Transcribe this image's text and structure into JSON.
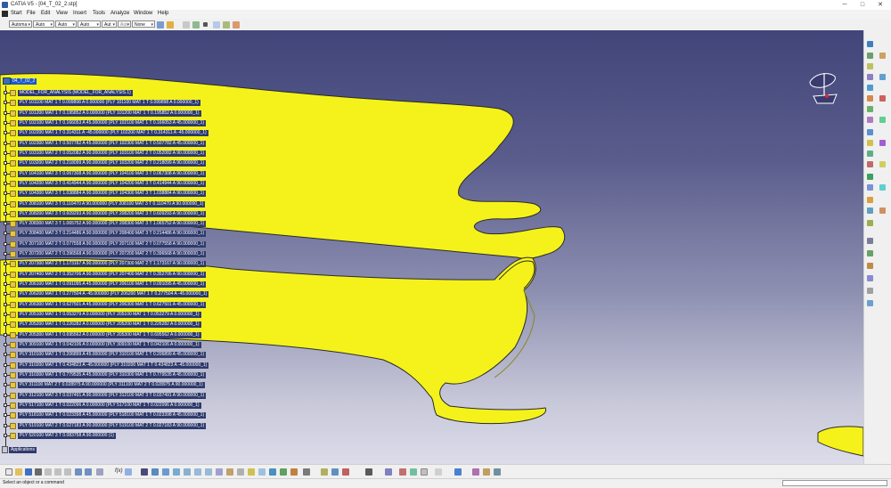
{
  "window": {
    "title": "CATIA V5 - [04_T_02_2.stp]",
    "minimize_glyph": "─",
    "maximize_glyph": "□",
    "close_glyph": "✕"
  },
  "menu": [
    "Start",
    "File",
    "Edit",
    "View",
    "Insert",
    "Tools",
    "Analyze",
    "Window",
    "Help"
  ],
  "properties_toolbar": {
    "selects": [
      "Automa",
      "Auto",
      "Auto",
      "Auto",
      "Aut",
      "Aut",
      "None"
    ]
  },
  "tree": {
    "root_label": "04_T_02_2",
    "rows": [
      {
        "label": "MODEL_FOR_ANALYSIS (MODEL_FOR_ANALYSIS.1)"
      },
      {
        "label": "PLY 101100 MAT 1 T 0.099898 A 0.000000 (PLY 101100 MAT 1 T 0.099898 A 0.000000_1)"
      },
      {
        "label": "PLY 101200 MAT 1 T 0.195852 A 0.000000 (PLY 101200 MAT 1 T 0.195852 A 0.000000_1)"
      },
      {
        "label": "PLY 102100 MAT 1 T 0.166053 A 45.000000 (PLY 102100 MAT 1 T 0.166053 A 45.000000_1)"
      },
      {
        "label": "PLY 102200 MAT 1 T 0.314311 A -45.000000 (PLY 102200 MAT 1 T 0.314311 A -45.000000_1)"
      },
      {
        "label": "PLY 102300 MAT 1 T 0.507782 A 45.000000 (PLY 102300 MAT 1 T 0.507782 A 45.000000_1)"
      },
      {
        "label": "PLY 103100 MAT 2 T 0.052082 A 90.000000 (PLY 103100 MAT 2 T 0.052082 A 90.000000_1)"
      },
      {
        "label": "PLY 103200 MAT 2 T 0.218099 A 90.000000 (PLY 103200 MAT 2 T 0.218099 A 90.000000_1)"
      },
      {
        "label": "PLY 104100 MAT 3 T 0.067308 A 90.000000 (PLY 104100 MAT 3 T 0.067308 A 90.000000_1)"
      },
      {
        "label": "PLY 104200 MAT 3 T 0.414944 A 90.000000 (PLY 104200 MAT 3 T 0.414944 A 90.000000_1)"
      },
      {
        "label": "PLY 104300 MAT 3 T 1.038884 A 90.000000 (PLY 104300 MAT 3 T 1.038884 A 90.000000_1)"
      },
      {
        "label": "PLY 208100 MAT 3 T 0.110470 A 90.000000 (PLY 208100 MAT 3 T 0.110470 A 90.000000_1)"
      },
      {
        "label": "PLY 208200 MAT 3 T 0.609293 A 90.000000 (PLY 208200 MAT 3 T 0.609293 A 90.000000_1)"
      },
      {
        "label": "PLY 208300 MAT 3 T 1.065752 A 90.000000 (PLY 208300 MAT 3 T 1.065752 A 90.000000_1)"
      },
      {
        "label": "PLY 208400 MAT 3 T 0.214486 A 90.000000 (PLY 208400 MAT 3 T 0.214486 A 90.000000_1)"
      },
      {
        "label": "PLY 207100 MAT 2 T 0.077558 A 90.000000 (PLY 207100 MAT 2 T 0.077558 A 90.000000_1)"
      },
      {
        "label": "PLY 207200 MAT 2 T 0.396568 A 90.000000 (PLY 207200 MAT 2 T 0.396568 A 90.000000_1)"
      },
      {
        "label": "PLY 207300 MAT 2 T 1.173167 A 90.000000 (PLY 207300 MAT 2 T 1.173167 A 90.000000_1)"
      },
      {
        "label": "PLY 207400 MAT 2 T 0.352706 A 90.000000 (PLY 207400 MAT 2 T 0.352706 A 90.000000_1)"
      },
      {
        "label": "PLY 206100 MAT 1 T 0.091095 A 45.000000 (PLY 206100 MAT 1 T 0.091095 A 45.000000_1)"
      },
      {
        "label": "PLY 206200 MAT 1 T 0.277504 A -45.000000 (PLY 206200 MAT 1 T 0.277504 A -45.000000_1)"
      },
      {
        "label": "PLY 206300 MAT 1 T 0.627501 A 45.000000 (PLY 206300 MAT 1 T 0.627501 A 45.000000_1)"
      },
      {
        "label": "PLY 205100 MAT 1 T 0.053279 A 0.000000 (PLY 205100 MAT 1 T 0.053279 A 0.000000_1)"
      },
      {
        "label": "PLY 205200 MAT 1 T 0.226282 A 0.000000 (PLY 205200 MAT 1 T 0.226282 A 0.000000_1)"
      },
      {
        "label": "PLY 205300 MAT 1 T 0.695562 A 0.000000 (PLY 205300 MAT 1 T 0.695562 A 0.000000_1)"
      },
      {
        "label": "PLY 309100 MAT 1 T 0.042106 A 0.000000 (PLY 309100 MAT 1 T 0.042106 A 0.000000_1)"
      },
      {
        "label": "PLY 310100 MAT 1 T 0.206899 A 45.000000 (PLY 310100 MAT 1 T 0.206899 A 45.000000_1)"
      },
      {
        "label": "PLY 310200 MAT 1 T 0.434823 A -45.000000 (PLY 310200 MAT 1 T 0.434823 A -45.000000_1)"
      },
      {
        "label": "PLY 310300 MAT 1 T 0.779535 A 45.000000 (PLY 310300 MAT 1 T 0.779535 A 45.000000_1)"
      },
      {
        "label": "PLY 311100 MAT 2 T 0.028975 A 90.000000 (PLY 311100 MAT 2 T 0.028975 A 90.000000_1)"
      },
      {
        "label": "PLY 312100 MAT 3 T 0.037491 A 90.000000 (PLY 312100 MAT 3 T 0.037491 A 90.000000_1)"
      },
      {
        "label": "PLY 517100 MAT 1 T 0.022096 A 0.000000 (PLY 517100 MAT 1 T 0.022096 A 0.000000_1)"
      },
      {
        "label": "PLY 518100 MAT 1 T 0.023398 A 45.000000 (PLY 518100 MAT 1 T 0.023398 A 45.000000_1)"
      },
      {
        "label": "PLY 519100 MAT 2 T 0.027183 A 90.000000 (PLY 519100 MAT 2 T 0.027183 A 90.000000_1)"
      },
      {
        "label": "PLY 520100 MAT 3 T 0.083758 A 90.000000 (1)"
      }
    ],
    "applications_label": "Applications"
  },
  "bottom_toolbar": {
    "fx_label": "f(x)"
  },
  "status": {
    "text": "Select an object or a command"
  },
  "colors": {
    "part_yellow": "#f4f21a",
    "viewport_top": "#414579",
    "viewport_bottom": "#dcdcea",
    "tree_highlight": "#2e3a6b",
    "root_highlight": "#1a58c9"
  }
}
